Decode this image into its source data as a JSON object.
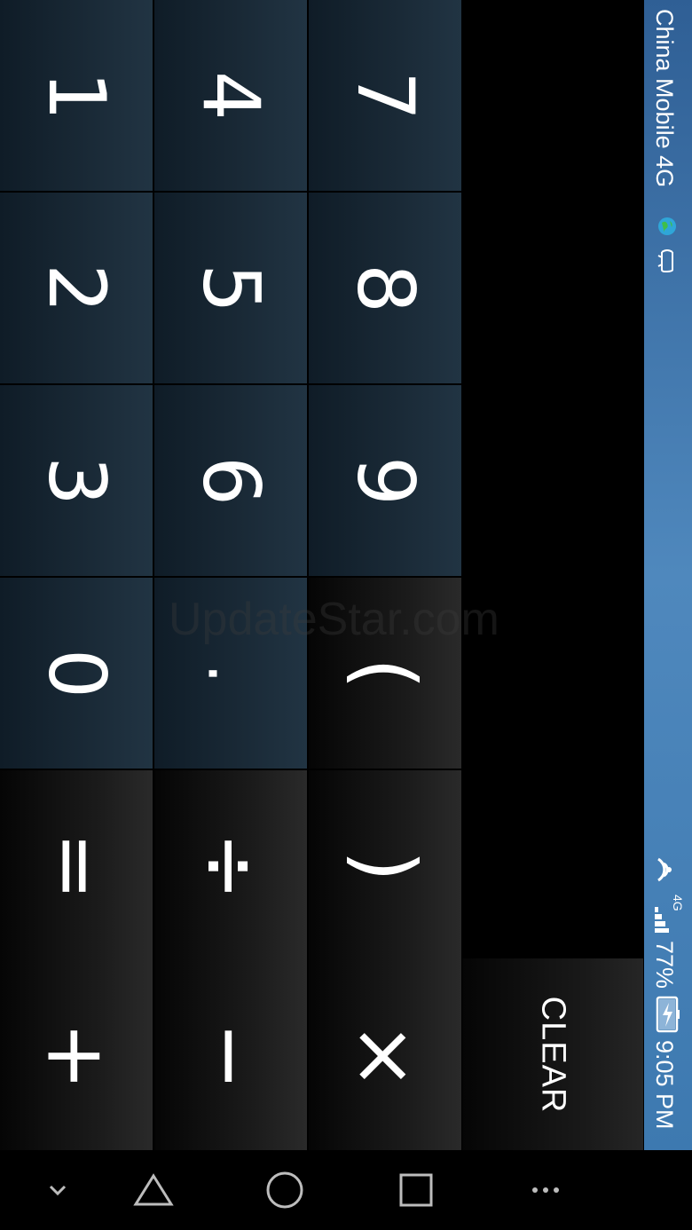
{
  "keys": {
    "one": "1",
    "four": "4",
    "seven": "7",
    "two": "2",
    "five": "5",
    "eight": "8",
    "three": "3",
    "six": "6",
    "nine": "9",
    "zero": "0",
    "dot": ".",
    "open_paren": "(",
    "equals": "=",
    "divide": "÷",
    "close_paren": ")",
    "plus": "+",
    "minus": "−",
    "multiply": "×",
    "clear": "CLEAR"
  },
  "status_bar": {
    "carrier": "China Mobile 4G",
    "time": "9:05 PM",
    "battery": "77%",
    "network_type": "4G",
    "colors": {
      "bg_top": "#2f5f95",
      "bg_bottom": "#3d79b0"
    }
  },
  "nav_bar": {
    "icons": [
      "chevron-down-icon",
      "back-triangle-icon",
      "home-circle-icon",
      "recents-square-icon",
      "more-dots-icon"
    ]
  },
  "watermark": "UpdateStar.com",
  "colors": {
    "number_key": "#1a2a37",
    "operator_key": "#1b1b1b",
    "background": "#000000"
  }
}
